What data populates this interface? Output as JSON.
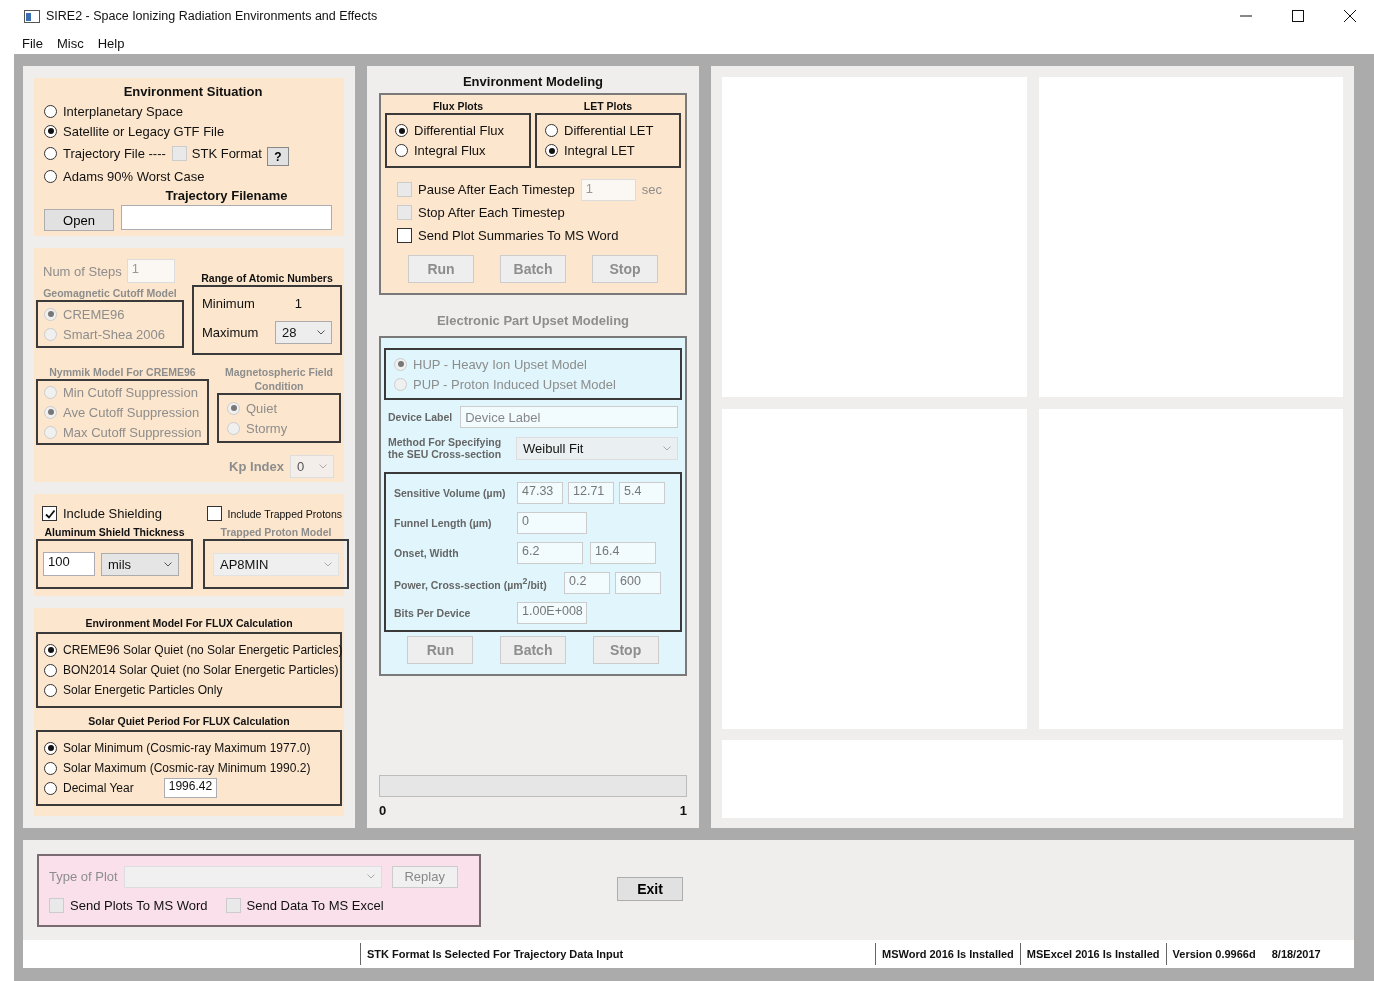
{
  "window": {
    "title": "SIRE2 - Space Ionizing Radiation Environments and Effects"
  },
  "menu": [
    "File",
    "Misc",
    "Help"
  ],
  "environment_situation": {
    "title": "Environment Situation",
    "options": [
      {
        "label": "Interplanetary Space",
        "selected": false
      },
      {
        "label": "Satellite or Legacy GTF File",
        "selected": true
      },
      {
        "label": "Trajectory File ----",
        "selected": false
      },
      {
        "label": "Adams 90% Worst Case",
        "selected": false
      }
    ],
    "stk_format": {
      "label": "STK Format",
      "checked": false,
      "disabled": true
    },
    "help_button": "?",
    "filename_label": "Trajectory Filename",
    "open_button": "Open"
  },
  "num_steps": {
    "label": "Num of Steps",
    "value": "1",
    "disabled": true
  },
  "atomic_range": {
    "title": "Range of Atomic Numbers",
    "minimum_label": "Minimum",
    "minimum_value": "1",
    "maximum_label": "Maximum",
    "maximum_value": "28"
  },
  "geomagnetic_cutoff": {
    "title": "Geomagnetic Cutoff Model",
    "disabled": true,
    "options": [
      {
        "label": "CREME96",
        "selected": true
      },
      {
        "label": "Smart-Shea 2006",
        "selected": false
      }
    ]
  },
  "nymmik_model": {
    "title": "Nymmik Model For CREME96",
    "disabled": true,
    "options": [
      {
        "label": "Min Cutoff Suppression",
        "selected": false
      },
      {
        "label": "Ave Cutoff Suppression",
        "selected": true
      },
      {
        "label": "Max Cutoff Suppression",
        "selected": false
      }
    ]
  },
  "magnetospheric_field": {
    "title": "Magnetospheric Field Condition",
    "disabled": true,
    "options": [
      {
        "label": "Quiet",
        "selected": true
      },
      {
        "label": "Stormy",
        "selected": false
      }
    ]
  },
  "kp_index": {
    "label": "Kp Index",
    "value": "0",
    "disabled": true
  },
  "shielding": {
    "include_shielding": {
      "label": "Include Shielding",
      "checked": true
    },
    "include_trapped_protons": {
      "label": "Include Trapped Protons",
      "checked": false
    },
    "thickness_title": "Aluminum Shield Thickness",
    "thickness_value": "100",
    "unit": "mils",
    "trapped_model_title": "Trapped Proton Model",
    "trapped_model": "AP8MIN",
    "trapped_disabled": true
  },
  "flux_model": {
    "title": "Environment Model For FLUX Calculation",
    "options": [
      {
        "label": "CREME96 Solar Quiet (no Solar Energetic Particles)",
        "selected": true
      },
      {
        "label": "BON2014 Solar Quiet (no Solar Energetic Particles)",
        "selected": false
      },
      {
        "label": "Solar Energetic Particles Only",
        "selected": false
      }
    ]
  },
  "solar_period": {
    "title": "Solar Quiet Period For FLUX Calculation",
    "options": [
      {
        "label": "Solar Minimum (Cosmic-ray Maximum 1977.0)",
        "selected": true
      },
      {
        "label": "Solar Maximum (Cosmic-ray Minimum 1990.2)",
        "selected": false
      },
      {
        "label": "Decimal Year",
        "selected": false,
        "value": "1996.42"
      }
    ]
  },
  "environment_modeling": {
    "title": "Environment Modeling",
    "flux_plots": {
      "title": "Flux Plots",
      "options": [
        {
          "label": "Differential Flux",
          "selected": true
        },
        {
          "label": "Integral Flux",
          "selected": false
        }
      ]
    },
    "let_plots": {
      "title": "LET Plots",
      "options": [
        {
          "label": "Differential LET",
          "selected": false
        },
        {
          "label": "Integral LET",
          "selected": true
        }
      ]
    },
    "checks": [
      {
        "label": "Pause After Each Timestep",
        "checked": false,
        "disabled": true,
        "value": "1",
        "unit": "sec"
      },
      {
        "label": "Stop After Each Timestep",
        "checked": false,
        "disabled": true
      },
      {
        "label": "Send Plot Summaries To MS Word",
        "checked": false,
        "disabled": false
      }
    ],
    "buttons": [
      {
        "label": "Run",
        "disabled": true
      },
      {
        "label": "Batch",
        "disabled": true
      },
      {
        "label": "Stop",
        "disabled": true
      }
    ]
  },
  "upset_modeling": {
    "title": "Electronic Part Upset Modeling",
    "disabled": true,
    "models": [
      {
        "label": "HUP - Heavy Ion Upset Model",
        "selected": true
      },
      {
        "label": "PUP - Proton Induced Upset Model",
        "selected": false
      }
    ],
    "device_label": {
      "label": "Device Label",
      "placeholder": "Device Label"
    },
    "method": {
      "label": "Method For Specifying the SEU Cross-section",
      "value": "Weibull Fit"
    },
    "params": [
      {
        "label": "Sensitive Volume (µm)",
        "values": [
          "47.33",
          "12.71",
          "5.4"
        ]
      },
      {
        "label": "Funnel Length (µm)",
        "values": [
          "0"
        ]
      },
      {
        "label": "Onset, Width",
        "values": [
          "6.2",
          "16.4"
        ]
      },
      {
        "label": "Power, Cross-section (µm$^{2}$/bit)",
        "values": [
          "0.2",
          "600"
        ]
      },
      {
        "label": "Bits Per Device",
        "values": [
          "1.00E+008"
        ]
      }
    ],
    "buttons": [
      {
        "label": "Run",
        "disabled": true
      },
      {
        "label": "Batch",
        "disabled": true
      },
      {
        "label": "Stop",
        "disabled": true
      }
    ]
  },
  "progress": {
    "level": 0,
    "min_label": "0",
    "max_label": "1"
  },
  "plot_output": {
    "type_label": "Type of Plot",
    "disabled": true,
    "replay_button": "Replay",
    "checks": [
      {
        "label": "Send Plots To MS Word",
        "checked": false
      },
      {
        "label": "Send Data To MS Excel",
        "checked": false
      }
    ]
  },
  "exit_button": "Exit",
  "status_bar": {
    "message": "STK Format Is Selected For Trajectory Data Input",
    "cells": [
      "MSWord 2016 Is Installed",
      "MSExcel 2016 Is Installed"
    ],
    "version": "Version 0.9966d",
    "date": "8/18/2017"
  }
}
